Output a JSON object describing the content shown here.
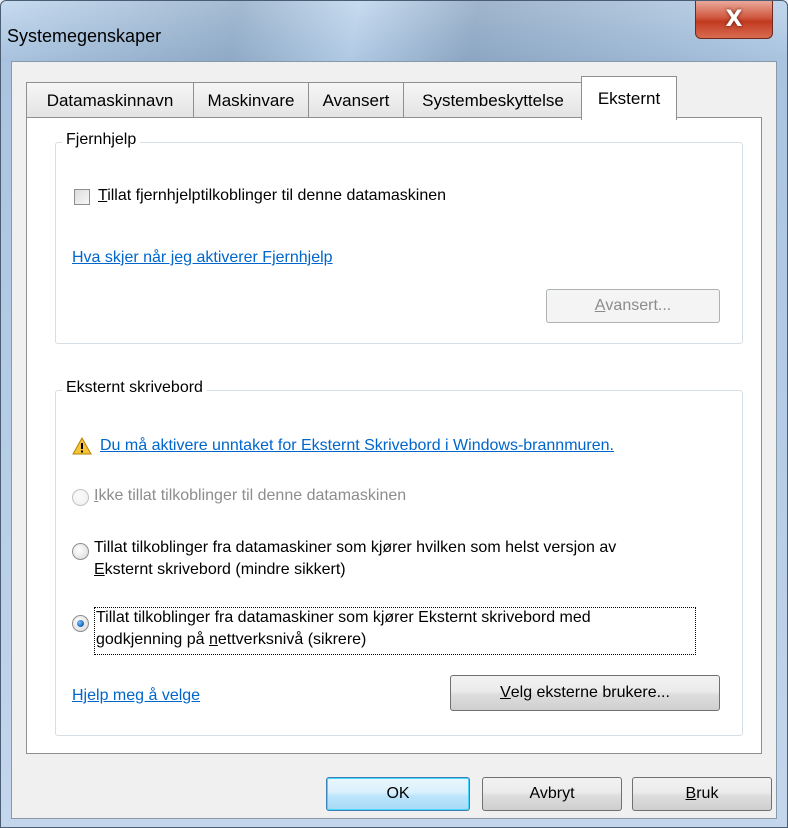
{
  "window": {
    "title": "Systemegenskaper",
    "close_icon": "close-icon",
    "close_glyph": "X",
    "close_color": "#c13a1f"
  },
  "tabs": [
    {
      "label": "Datamaskinnavn",
      "active": false
    },
    {
      "label": "Maskinvare",
      "active": false
    },
    {
      "label": "Avansert",
      "active": false
    },
    {
      "label": "Systembeskyttelse",
      "active": false
    },
    {
      "label": "Eksternt",
      "active": true
    }
  ],
  "remote_assistance": {
    "group_title": "Fjernhjelp",
    "checkbox_label": "Tillat fjernhjelptilkoblinger til denne datamaskinen",
    "checkbox_mnemonic": "T",
    "checkbox_rest": "illat fjernhjelptilkoblinger til denne datamaskinen",
    "checked": false,
    "help_link": "Hva skjer når jeg aktiverer Fjernhjelp",
    "advanced_button": "Avansert...",
    "advanced_mnemonic": "A",
    "advanced_rest": "vansert...",
    "advanced_enabled": false
  },
  "remote_desktop": {
    "group_title": "Eksternt skrivebord",
    "warning_icon": "warning-icon",
    "warning_link": "Du må aktivere unntaket for Eksternt Skrivebord i Windows-brannmuren.",
    "options": [
      {
        "line1": "Ikke tillat tilkoblinger til denne datamaskinen",
        "line2": "",
        "selected": false,
        "enabled": false
      },
      {
        "line1": "Tillat tilkoblinger fra datamaskiner som kjører hvilken som helst versjon av",
        "line2": "Eksternt skrivebord (mindre sikkert)",
        "selected": false,
        "enabled": true
      },
      {
        "line1": "Tillat tilkoblinger fra datamaskiner som kjører Eksternt skrivebord med",
        "line2": "godkjenning på nettverksnivå (sikrere)",
        "selected": true,
        "enabled": true
      }
    ],
    "option1_mn": "I",
    "option1_rest": "kke tillat tilkoblinger til denne datamaskinen",
    "option2_line2_mn": "E",
    "option2_line2_rest": "ksternt skrivebord (mindre sikkert)",
    "option3_line2_a": "godkjenning på ",
    "option3_line2_mn": "n",
    "option3_line2_b": "ettverksnivå (sikrere)",
    "help_link": "Hjelp meg å velge",
    "select_users_mn": "V",
    "select_users_rest": "elg eksterne brukere...",
    "select_users_button": "Velg eksterne brukere..."
  },
  "footer": {
    "ok": "OK",
    "cancel": "Avbryt",
    "apply": "Bruk",
    "apply_mn": "B",
    "apply_rest": "ruk"
  }
}
